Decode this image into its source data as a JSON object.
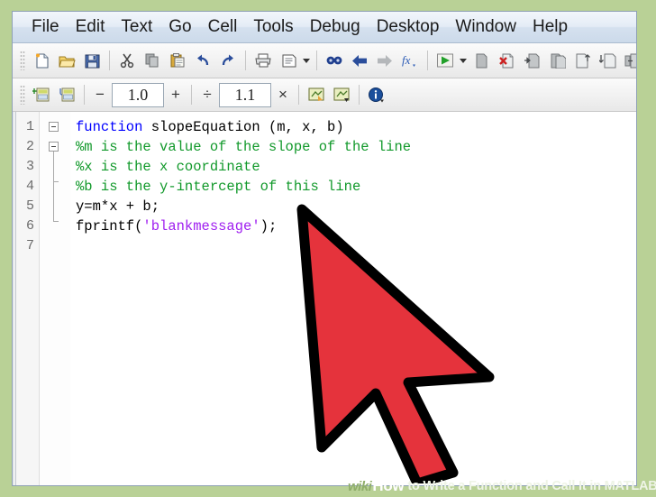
{
  "window": {
    "app": "MATLAB Editor",
    "accent_green": "#b9d196",
    "menubar_bg": "#e4ecf6"
  },
  "menubar": {
    "items": [
      {
        "label": "File",
        "name": "menu-file"
      },
      {
        "label": "Edit",
        "name": "menu-edit"
      },
      {
        "label": "Text",
        "name": "menu-text"
      },
      {
        "label": "Go",
        "name": "menu-go"
      },
      {
        "label": "Cell",
        "name": "menu-cell"
      },
      {
        "label": "Tools",
        "name": "menu-tools"
      },
      {
        "label": "Debug",
        "name": "menu-debug"
      },
      {
        "label": "Desktop",
        "name": "menu-desktop"
      },
      {
        "label": "Window",
        "name": "menu-window"
      },
      {
        "label": "Help",
        "name": "menu-help"
      }
    ]
  },
  "toolbar_main": {
    "groups": [
      [
        "new-file-icon",
        "open-folder-icon",
        "save-icon"
      ],
      [
        "cut-icon",
        "copy-icon",
        "paste-icon",
        "undo-icon",
        "redo-icon"
      ],
      [
        "print-icon",
        "print-preview-icon",
        "print-dropdown-caret"
      ],
      [
        "find-icon",
        "back-arrow-icon",
        "forward-arrow-icon",
        "function-browser-icon"
      ],
      [
        "run-icon",
        "run-dropdown-caret",
        "save-run-icon",
        "clear-breakpoints-icon",
        "step-icon",
        "step-in-icon",
        "step-out-icon",
        "continue-icon",
        "exit-debug-icon"
      ]
    ]
  },
  "toolbar_cell": {
    "insert_cell_icon": "insert-cell-icon",
    "insert_cell_divider_icon": "insert-cell-divider-icon",
    "minus_label": "−",
    "value_decrement": "1.0",
    "plus_label": "+",
    "divide_label": "÷",
    "value_divide": "1.1",
    "multiply_label": "×",
    "eval_cell_icon": "evaluate-cell-icon",
    "eval_cell_advance_icon": "evaluate-cell-advance-icon",
    "info_icon": "info-icon"
  },
  "editor": {
    "line_numbers": [
      "1",
      "2",
      "3",
      "4",
      "5",
      "6",
      "7"
    ],
    "lines": [
      {
        "number": "1",
        "fold": "box",
        "tokens": [
          {
            "text": "function",
            "type": "keyword"
          },
          {
            "text": " slopeEquation (m, x, b)",
            "type": "plain"
          }
        ]
      },
      {
        "number": "2",
        "fold": "box",
        "tokens": [
          {
            "text": "%m is the value of the slope of the line",
            "type": "comment"
          }
        ]
      },
      {
        "number": "3",
        "fold": "line",
        "tokens": [
          {
            "text": "%x is the x coordinate",
            "type": "comment"
          }
        ]
      },
      {
        "number": "4",
        "fold": "tick",
        "tokens": [
          {
            "text": "%b is the y-intercept of this line",
            "type": "comment"
          }
        ]
      },
      {
        "number": "5",
        "fold": "line",
        "tokens": [
          {
            "text": "y=m*x + b;",
            "type": "plain"
          }
        ]
      },
      {
        "number": "6",
        "fold": "end",
        "tokens": [
          {
            "text": "fprintf(",
            "type": "plain"
          },
          {
            "text": "'blankmessage'",
            "type": "string"
          },
          {
            "text": ");",
            "type": "plain"
          }
        ]
      },
      {
        "number": "7",
        "fold": "none",
        "tokens": []
      }
    ],
    "syntax_colors": {
      "keyword": "#0000ff",
      "comment": "#12992b",
      "string": "#a020f0",
      "plain": "#000000"
    }
  },
  "cursor": {
    "name": "mouse-pointer-arrow",
    "fill": "#e5333c",
    "stroke": "#000000"
  },
  "watermark": {
    "wiki": "wiki",
    "how": "How",
    "rest": "to Write a Function and Call It in MATLAB"
  }
}
